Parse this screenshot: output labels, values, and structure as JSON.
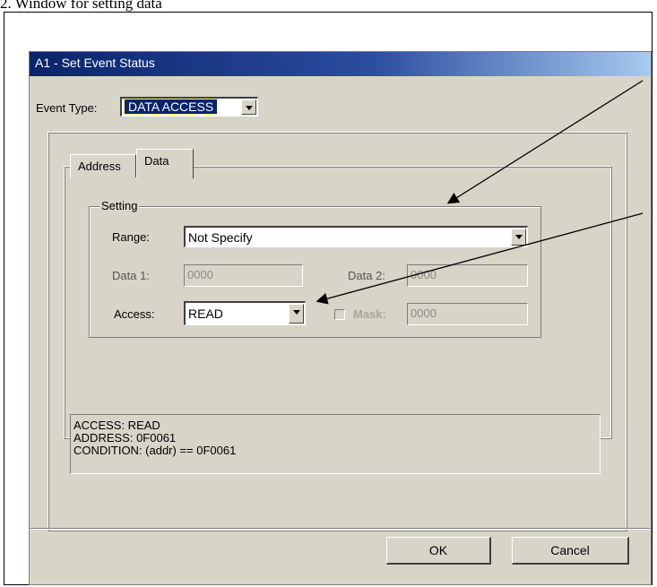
{
  "document": {
    "heading": "2. Window for setting data"
  },
  "dialog": {
    "title": "A1 - Set Event Status",
    "event_type": {
      "label": "Event Type:",
      "value": "DATA ACCESS"
    },
    "tabs": [
      {
        "label": "Address",
        "active": false
      },
      {
        "label": "Data",
        "active": true
      }
    ],
    "setting": {
      "legend": "Setting",
      "range": {
        "label": "Range:",
        "value": "Not Specify"
      },
      "data1": {
        "label": "Data 1:",
        "value": "0000",
        "enabled": false
      },
      "data2": {
        "label": "Data 2:",
        "value": "0000",
        "enabled": false
      },
      "access": {
        "label": "Access:",
        "value": "READ"
      },
      "mask": {
        "label": "Mask:",
        "value": "0000",
        "checked": false,
        "enabled": false
      }
    },
    "info_lines": [
      "ACCESS: READ",
      "ADDRESS: 0F0061",
      "CONDITION: (addr) == 0F0061"
    ],
    "buttons": {
      "ok": "OK",
      "cancel": "Cancel"
    }
  },
  "colors": {
    "dialog_face": "#d8d4c8",
    "title_start": "#0a246a",
    "title_end": "#a6caf0",
    "selection": "#0a246a"
  }
}
